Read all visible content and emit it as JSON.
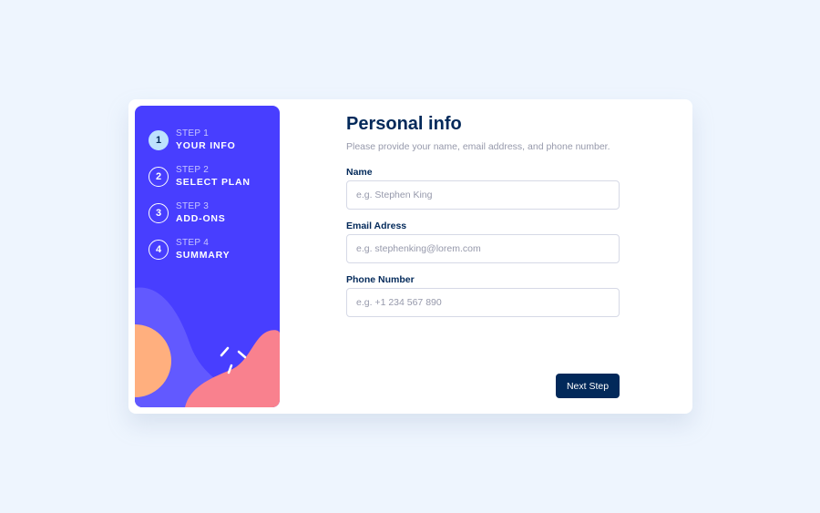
{
  "steps": [
    {
      "number": "1",
      "label": "STEP 1",
      "title": "YOUR INFO",
      "active": true
    },
    {
      "number": "2",
      "label": "STEP 2",
      "title": "SELECT PLAN",
      "active": false
    },
    {
      "number": "3",
      "label": "STEP 3",
      "title": "ADD-ONS",
      "active": false
    },
    {
      "number": "4",
      "label": "STEP 4",
      "title": "SUMMARY",
      "active": false
    }
  ],
  "form": {
    "title": "Personal info",
    "subtitle": "Please provide your name, email address, and phone number.",
    "name_label": "Name",
    "name_placeholder": "e.g. Stephen King",
    "email_label": "Email Adress",
    "email_placeholder": "e.g. stephenking@lorem.com",
    "phone_label": "Phone Number",
    "phone_placeholder": "e.g. +1 234 567 890",
    "next_label": "Next Step"
  },
  "colors": {
    "sidebar_bg": "#483eff",
    "active_step": "#bee2fd",
    "primary_text": "#02295a",
    "page_bg": "#eef5fe"
  }
}
